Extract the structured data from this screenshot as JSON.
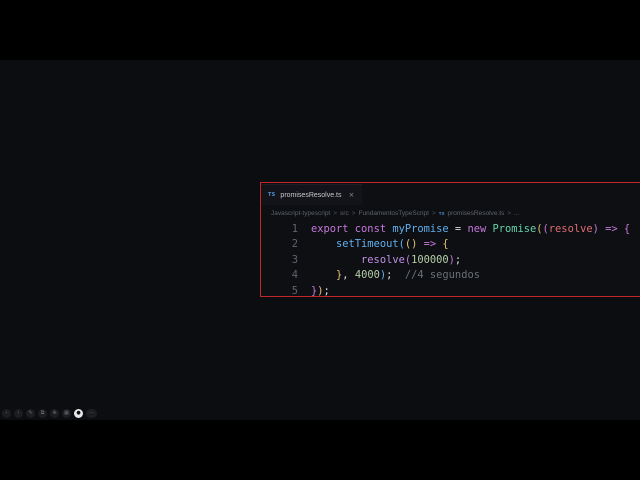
{
  "editor": {
    "tab": {
      "badge": "TS",
      "filename": "promisesResolve.ts",
      "close": "×"
    },
    "breadcrumb": [
      {
        "label": "Javascript-typescript",
        "ts": false
      },
      {
        "label": "src",
        "ts": false
      },
      {
        "label": "FundamentosTypeScript",
        "ts": false
      },
      {
        "label": "promisesResolve.ts",
        "ts": true
      },
      {
        "label": "...",
        "ts": false
      }
    ],
    "breadcrumb_separator": ">",
    "ts_badge": "TS",
    "code_lines": [
      {
        "n": "1",
        "tokens": [
          {
            "t": "export ",
            "c": "kw"
          },
          {
            "t": "const ",
            "c": "kw"
          },
          {
            "t": "myPromise",
            "c": "fn"
          },
          {
            "t": " = ",
            "c": "plain"
          },
          {
            "t": "new ",
            "c": "kw"
          },
          {
            "t": "Promise",
            "c": "cls"
          },
          {
            "t": "(",
            "c": "b1"
          },
          {
            "t": "(",
            "c": "b2"
          },
          {
            "t": "resolve",
            "c": "param"
          },
          {
            "t": ")",
            "c": "b2"
          },
          {
            "t": " => ",
            "c": "kw"
          },
          {
            "t": "{",
            "c": "b2"
          }
        ]
      },
      {
        "n": "2",
        "tokens": [
          {
            "t": "    ",
            "c": "plain"
          },
          {
            "t": "setTimeout",
            "c": "fn"
          },
          {
            "t": "(",
            "c": "b3"
          },
          {
            "t": "()",
            "c": "b1"
          },
          {
            "t": " => ",
            "c": "kw"
          },
          {
            "t": "{",
            "c": "b1"
          }
        ]
      },
      {
        "n": "3",
        "tokens": [
          {
            "t": "        ",
            "c": "plain"
          },
          {
            "t": "resolve",
            "c": "fnp"
          },
          {
            "t": "(",
            "c": "b2"
          },
          {
            "t": "100000",
            "c": "num"
          },
          {
            "t": ")",
            "c": "b2"
          },
          {
            "t": ";",
            "c": "plain"
          }
        ]
      },
      {
        "n": "4",
        "tokens": [
          {
            "t": "    ",
            "c": "plain"
          },
          {
            "t": "}",
            "c": "b1"
          },
          {
            "t": ", ",
            "c": "plain"
          },
          {
            "t": "4000",
            "c": "num"
          },
          {
            "t": ")",
            "c": "b3"
          },
          {
            "t": ";  ",
            "c": "plain"
          },
          {
            "t": "//4 segundos",
            "c": "cmt"
          }
        ]
      },
      {
        "n": "5",
        "tokens": [
          {
            "t": "}",
            "c": "b2"
          },
          {
            "t": ")",
            "c": "b1"
          },
          {
            "t": ";",
            "c": "plain"
          }
        ]
      }
    ]
  },
  "player_controls": [
    {
      "name": "previous-icon",
      "glyph": "‹"
    },
    {
      "name": "next-icon",
      "glyph": "›"
    },
    {
      "name": "pen-icon",
      "glyph": "✎"
    },
    {
      "name": "copy-icon",
      "glyph": "⧉"
    },
    {
      "name": "zoom-icon",
      "glyph": "⊕"
    },
    {
      "name": "grid-icon",
      "glyph": "▦"
    },
    {
      "name": "active-control-icon",
      "glyph": "●",
      "active": true
    },
    {
      "name": "more-icon",
      "glyph": "⋯",
      "pill": true
    }
  ],
  "colors": {
    "highlight_border": "#c3262a",
    "keyword": "#c678dd",
    "function": "#61afef",
    "class": "#62d3a8",
    "number": "#b5cea8",
    "comment": "#6a7078"
  }
}
